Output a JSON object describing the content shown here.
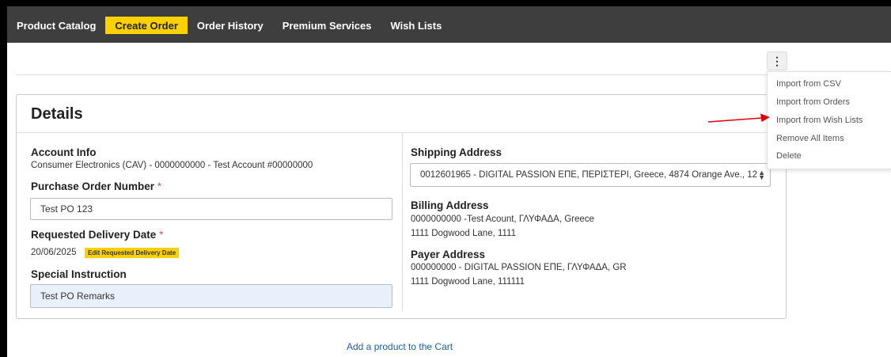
{
  "nav": {
    "items": [
      {
        "label": "Product Catalog",
        "active": false
      },
      {
        "label": "Create Order",
        "active": true
      },
      {
        "label": "Order History",
        "active": false
      },
      {
        "label": "Premium Services",
        "active": false
      },
      {
        "label": "Wish Lists",
        "active": false
      }
    ],
    "colors": {
      "bar": "#3e3e3e",
      "active": "#fdd000"
    }
  },
  "menu": {
    "kebab_icon": "⋮",
    "items": [
      "Import from CSV",
      "Import from Orders",
      "Import from Wish Lists",
      "Remove All Items",
      "Delete"
    ]
  },
  "details": {
    "title": "Details",
    "account_info": {
      "label": "Account Info",
      "value": "Consumer Electronics (CAV) - 0000000000 - Test Account #00000000"
    },
    "po_number": {
      "label": "Purchase Order Number",
      "required_mark": "*",
      "value": "Test PO 123"
    },
    "delivery_date": {
      "label": "Requested Delivery Date",
      "required_mark": "*",
      "value": "20/06/2025",
      "edit_button": "Edit Requested Delivery Date"
    },
    "special_instruction": {
      "label": "Special Instruction",
      "value": "Test PO Remarks"
    },
    "shipping_address": {
      "label": "Shipping Address",
      "selected": "0012601965 - DIGITAL PASSION ΕΠΕ, ΠΕΡΙΣΤΕΡΙ, Greece, 4874 Orange Ave., 12"
    },
    "billing_address": {
      "label": "Billing Address",
      "line1": "0000000000 -Test Acount, ΓΛΥΦΑΔΑ, Greece",
      "line2": "1111 Dogwood Lane, 1111"
    },
    "payer_address": {
      "label": "Payer Address",
      "line1": "000000000 - DIGITAL PASSION ΕΠΕ, ΓΛΥΦΑΔΑ, GR",
      "line2": "1111 Dogwood Lane, 111111"
    }
  },
  "footer": {
    "add_product_link": "Add a product to the Cart"
  },
  "annotation": {
    "arrow_color": "#e00000"
  }
}
